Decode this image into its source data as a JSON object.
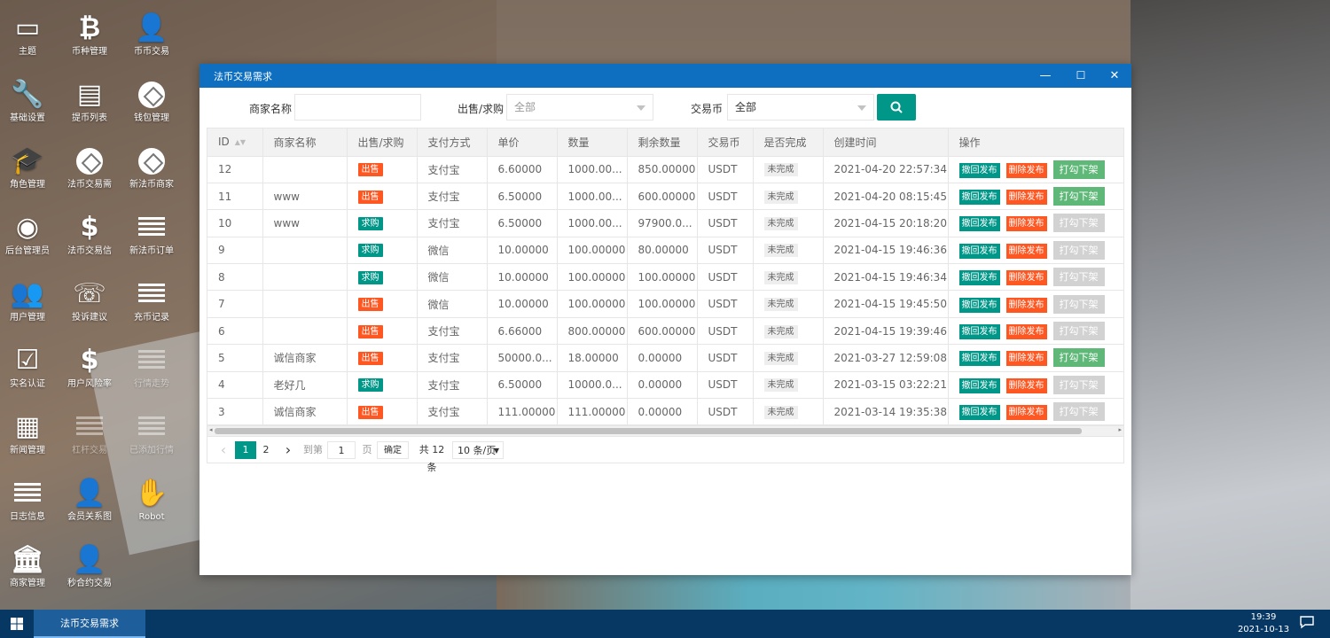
{
  "desktop": {
    "icons": [
      {
        "label": "主题",
        "icon": "monitor-icon",
        "dim": false
      },
      {
        "label": "币种管理",
        "icon": "bitcoin-icon",
        "dim": false
      },
      {
        "label": "币币交易",
        "icon": "add-user-icon",
        "dim": false
      },
      {
        "label": "基础设置",
        "icon": "wrench-icon",
        "dim": false
      },
      {
        "label": "提币列表",
        "icon": "card-icon",
        "dim": false
      },
      {
        "label": "钱包管理",
        "icon": "swap-icon",
        "dim": false
      },
      {
        "label": "角色管理",
        "icon": "graduation-cap-icon",
        "dim": false
      },
      {
        "label": "法币交易需",
        "icon": "swap-icon",
        "dim": false
      },
      {
        "label": "新法币商家",
        "icon": "swap-icon",
        "dim": false
      },
      {
        "label": "后台管理员",
        "icon": "user-circle-icon",
        "dim": false
      },
      {
        "label": "法币交易信",
        "icon": "dollar-icon",
        "dim": false
      },
      {
        "label": "新法币订单",
        "icon": "list-icon",
        "dim": false
      },
      {
        "label": "用户管理",
        "icon": "users-icon",
        "dim": false
      },
      {
        "label": "投诉建议",
        "icon": "phone-icon",
        "dim": false
      },
      {
        "label": "充币记录",
        "icon": "list-icon",
        "dim": false
      },
      {
        "label": "实名认证",
        "icon": "checkbox-icon",
        "dim": false
      },
      {
        "label": "用户风险率",
        "icon": "dollar-icon",
        "dim": false
      },
      {
        "label": "行情走势",
        "icon": "list-icon",
        "dim": true
      },
      {
        "label": "新闻管理",
        "icon": "newspaper-icon",
        "dim": false
      },
      {
        "label": "杠杆交易",
        "icon": "list-icon",
        "dim": true
      },
      {
        "label": "已添加行情",
        "icon": "list-icon",
        "dim": true
      },
      {
        "label": "日志信息",
        "icon": "list-icon",
        "dim": false
      },
      {
        "label": "会员关系图",
        "icon": "add-user-icon",
        "dim": false
      },
      {
        "label": "Robot",
        "icon": "robot-hand-icon",
        "dim": false
      },
      {
        "label": "商家管理",
        "icon": "bank-icon",
        "dim": false
      },
      {
        "label": "秒合约交易",
        "icon": "add-user-icon",
        "dim": false
      }
    ]
  },
  "window": {
    "title": "法币交易需求",
    "minimize": "—",
    "maximize": "☐",
    "close": "✕"
  },
  "filters": {
    "merchant_label": "商家名称",
    "merchant_value": "",
    "type_label": "出售/求购",
    "type_value": "全部",
    "coin_label": "交易币",
    "coin_value": "全部",
    "search_icon": "search-icon"
  },
  "table": {
    "columns": [
      "ID",
      "商家名称",
      "出售/求购",
      "支付方式",
      "单价",
      "数量",
      "剩余数量",
      "交易币",
      "是否完成",
      "创建时间",
      "操作"
    ],
    "rows": [
      {
        "id": "12",
        "merchant": "",
        "type": "出售",
        "type_kind": "sell",
        "pay": "支付宝",
        "price": "6.60000",
        "qty": "1000.00...",
        "remain": "850.00000",
        "coin": "USDT",
        "done": "未完成",
        "time": "2021-04-20 22:57:34",
        "op3_on": true
      },
      {
        "id": "11",
        "merchant": "www",
        "type": "出售",
        "type_kind": "sell",
        "pay": "支付宝",
        "price": "6.50000",
        "qty": "1000.00...",
        "remain": "600.00000",
        "coin": "USDT",
        "done": "未完成",
        "time": "2021-04-20 08:15:45",
        "op3_on": true
      },
      {
        "id": "10",
        "merchant": "www",
        "type": "求购",
        "type_kind": "buy",
        "pay": "支付宝",
        "price": "6.50000",
        "qty": "1000.00...",
        "remain": "97900.0...",
        "coin": "USDT",
        "done": "未完成",
        "time": "2021-04-15 20:18:20",
        "op3_on": false
      },
      {
        "id": "9",
        "merchant": "",
        "type": "求购",
        "type_kind": "buy",
        "pay": "微信",
        "price": "10.00000",
        "qty": "100.00000",
        "remain": "80.00000",
        "coin": "USDT",
        "done": "未完成",
        "time": "2021-04-15 19:46:36",
        "op3_on": false
      },
      {
        "id": "8",
        "merchant": "",
        "type": "求购",
        "type_kind": "buy",
        "pay": "微信",
        "price": "10.00000",
        "qty": "100.00000",
        "remain": "100.00000",
        "coin": "USDT",
        "done": "未完成",
        "time": "2021-04-15 19:46:34",
        "op3_on": false
      },
      {
        "id": "7",
        "merchant": "",
        "type": "出售",
        "type_kind": "sell",
        "pay": "微信",
        "price": "10.00000",
        "qty": "100.00000",
        "remain": "100.00000",
        "coin": "USDT",
        "done": "未完成",
        "time": "2021-04-15 19:45:50",
        "op3_on": false
      },
      {
        "id": "6",
        "merchant": "",
        "type": "出售",
        "type_kind": "sell",
        "pay": "支付宝",
        "price": "6.66000",
        "qty": "800.00000",
        "remain": "600.00000",
        "coin": "USDT",
        "done": "未完成",
        "time": "2021-04-15 19:39:46",
        "op3_on": false
      },
      {
        "id": "5",
        "merchant": "诚信商家",
        "type": "出售",
        "type_kind": "sell",
        "pay": "支付宝",
        "price": "50000.0...",
        "qty": "18.00000",
        "remain": "0.00000",
        "coin": "USDT",
        "done": "未完成",
        "time": "2021-03-27 12:59:08",
        "op3_on": true
      },
      {
        "id": "4",
        "merchant": "老好几",
        "type": "求购",
        "type_kind": "buy",
        "pay": "支付宝",
        "price": "6.50000",
        "qty": "10000.0...",
        "remain": "0.00000",
        "coin": "USDT",
        "done": "未完成",
        "time": "2021-03-15 03:22:21",
        "op3_on": false
      },
      {
        "id": "3",
        "merchant": "诚信商家",
        "type": "出售",
        "type_kind": "sell",
        "pay": "支付宝",
        "price": "111.00000",
        "qty": "111.00000",
        "remain": "0.00000",
        "coin": "USDT",
        "done": "未完成",
        "time": "2021-03-14 19:35:38",
        "op3_on": false
      }
    ],
    "op_labels": {
      "withdraw": "撤回发布",
      "delete": "删除发布",
      "toggle": "打勾下架"
    }
  },
  "pagination": {
    "prev": "‹",
    "pages": [
      "1",
      "2"
    ],
    "current": "1",
    "next": "›",
    "goto_label": "到第",
    "goto_value": "1",
    "page_unit": "页",
    "confirm": "确定",
    "total": "共 12 条",
    "page_size": "10 条/页"
  },
  "taskbar": {
    "task_label": "法币交易需求",
    "time": "19:39",
    "date": "2021-10-13"
  },
  "colors": {
    "titlebar": "#0e6fc1",
    "taskbar": "#073763",
    "sell": "#ff5722",
    "buy": "#009688",
    "toggle_on": "#5fb878",
    "toggle_off": "#d2d2d2"
  }
}
